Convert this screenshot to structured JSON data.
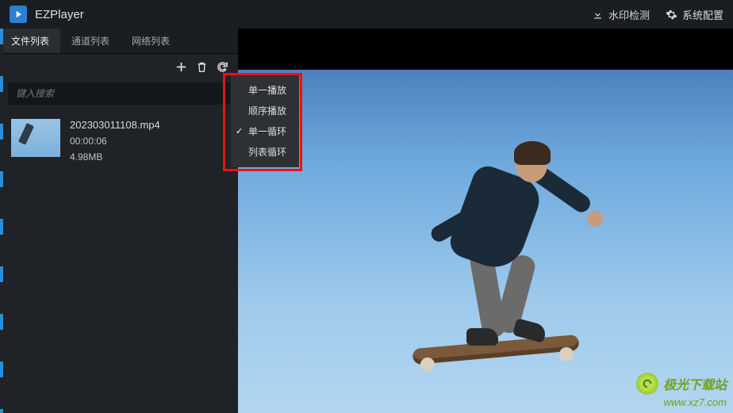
{
  "app": {
    "title": "EZPlayer"
  },
  "titlebar": {
    "watermark_btn": "水印检测",
    "config_btn": "系统配置"
  },
  "tabs": {
    "file_list": "文件列表",
    "channel_list": "通道列表",
    "network_list": "网络列表"
  },
  "search": {
    "placeholder": "键入搜索"
  },
  "file": {
    "name": "202303011108.mp4",
    "duration": "00:00:06",
    "size": "4.98MB"
  },
  "playback_menu": {
    "single_play": "单一播放",
    "sequential": "顺序播放",
    "single_loop": "单一循环",
    "list_loop": "列表循环"
  },
  "watermark": {
    "text": "极光下载站",
    "url": "www.xz7.com"
  }
}
